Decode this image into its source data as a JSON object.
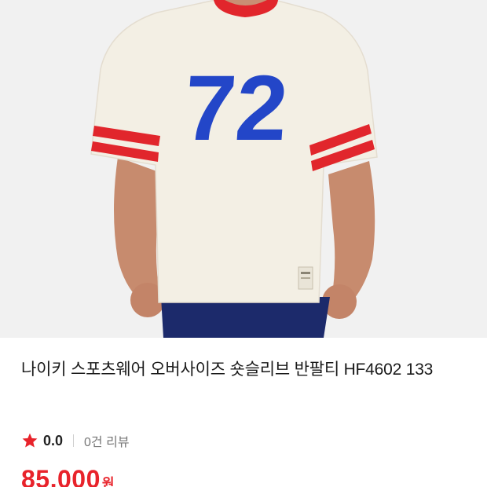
{
  "product": {
    "image_alt": "나이키 스포츠웨어 오버사이즈 숏슬리브 반팔티 HF4602 133",
    "jersey_number": "72",
    "title": "나이키 스포츠웨어 오버사이즈 숏슬리브 반팔티 HF4602 133",
    "rating": "0.0",
    "review_count": "0건 리뷰",
    "price": "85,000",
    "currency": "원"
  },
  "colors": {
    "price": "#e8232b",
    "star": "#e8232b",
    "shirt": "#f3efe4",
    "trim": "#e1262c",
    "number": "#2346c8",
    "shorts": "#1c2a6b"
  },
  "icons": {
    "rating": "star-icon"
  }
}
